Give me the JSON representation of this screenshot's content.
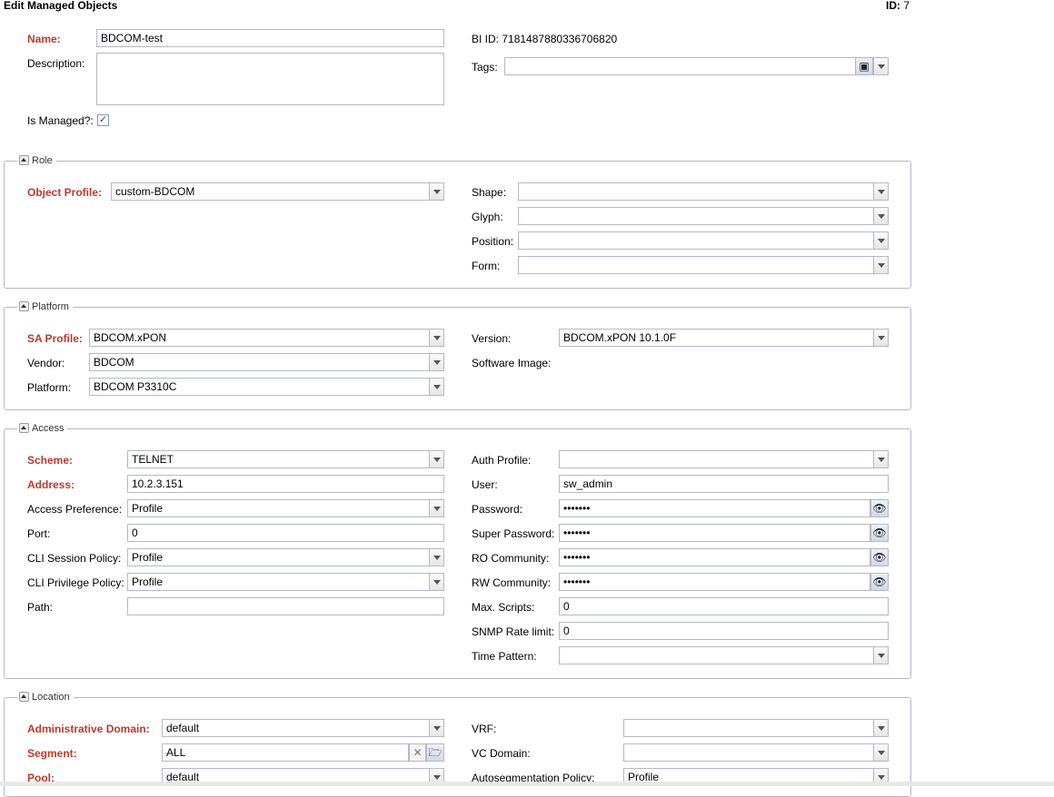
{
  "header": {
    "title": "Edit Managed Objects",
    "id_label": "ID:",
    "id_value": "7"
  },
  "main": {
    "name_label": "Name:",
    "name_value": "BDCOM-test",
    "description_label": "Description:",
    "description_value": "",
    "bi_id_label": "BI ID:",
    "bi_id_value": "7181487880336706820",
    "tags_label": "Tags:",
    "tags_value": "",
    "is_managed_label": "Is Managed?:",
    "is_managed_checked": true
  },
  "role": {
    "legend": "Role",
    "object_profile_label": "Object Profile:",
    "object_profile_value": "custom-BDCOM",
    "shape_label": "Shape:",
    "shape_value": "",
    "glyph_label": "Glyph:",
    "glyph_value": "",
    "position_label": "Position:",
    "position_value": "",
    "form_label": "Form:",
    "form_value": ""
  },
  "platform": {
    "legend": "Platform",
    "sa_profile_label": "SA Profile:",
    "sa_profile_value": "BDCOM.xPON",
    "vendor_label": "Vendor:",
    "vendor_value": "BDCOM",
    "platform_label": "Platform:",
    "platform_value": "BDCOM P3310C",
    "version_label": "Version:",
    "version_value": "BDCOM.xPON 10.1.0F",
    "software_image_label": "Software Image:"
  },
  "access": {
    "legend": "Access",
    "scheme_label": "Scheme:",
    "scheme_value": "TELNET",
    "address_label": "Address:",
    "address_value": "10.2.3.151",
    "access_pref_label": "Access Preference:",
    "access_pref_value": "Profile",
    "port_label": "Port:",
    "port_value": "0",
    "cli_session_label": "CLI Session Policy:",
    "cli_session_value": "Profile",
    "cli_privilege_label": "CLI Privilege Policy:",
    "cli_privilege_value": "Profile",
    "path_label": "Path:",
    "path_value": "",
    "auth_profile_label": "Auth Profile:",
    "auth_profile_value": "",
    "user_label": "User:",
    "user_value": "sw_admin",
    "password_label": "Password:",
    "password_value": "•••••••",
    "super_password_label": "Super Password:",
    "super_password_value": "•••••••",
    "ro_community_label": "RO Community:",
    "ro_community_value": "•••••••",
    "rw_community_label": "RW Community:",
    "rw_community_value": "•••••••",
    "max_scripts_label": "Max. Scripts:",
    "max_scripts_value": "0",
    "snmp_rate_label": "SNMP Rate limit:",
    "snmp_rate_value": "0",
    "time_pattern_label": "Time Pattern:",
    "time_pattern_value": ""
  },
  "location": {
    "legend": "Location",
    "admin_domain_label": "Administrative Domain:",
    "admin_domain_value": "default",
    "segment_label": "Segment:",
    "segment_value": "ALL",
    "pool_label": "Pool:",
    "pool_value": "default",
    "vrf_label": "VRF:",
    "vrf_value": "",
    "vc_domain_label": "VC Domain:",
    "vc_domain_value": "",
    "autoseg_label": "Autosegmentation Policy:",
    "autoseg_value": "Profile"
  },
  "icons": {
    "reveal": "eye-icon",
    "clear": "clear-icon",
    "browse": "folder-icon",
    "paste": "paste-icon"
  }
}
